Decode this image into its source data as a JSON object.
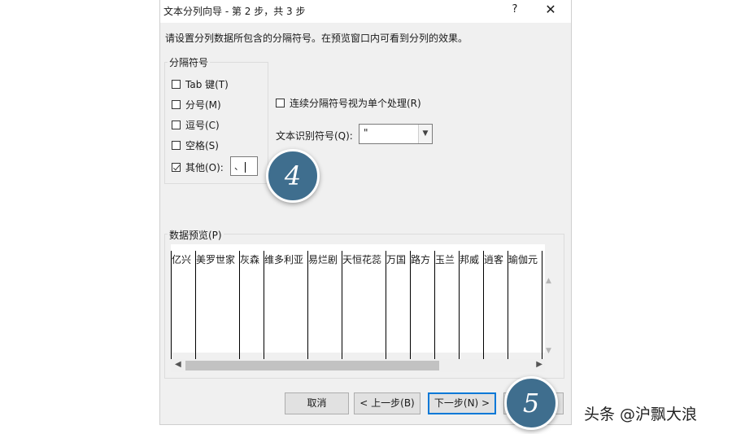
{
  "dialog": {
    "title": "文本分列向导 - 第 2 步，共 3 步",
    "help": "?",
    "close": "✕",
    "instruction": "请设置分列数据所包含的分隔符号。在预览窗口内可看到分列的效果。"
  },
  "delimiters": {
    "group_label": "分隔符号",
    "tab": {
      "label": "Tab 键(T)",
      "checked": false
    },
    "semicolon": {
      "label": "分号(M)",
      "checked": false
    },
    "comma": {
      "label": "逗号(C)",
      "checked": false
    },
    "space": {
      "label": "空格(S)",
      "checked": false
    },
    "other": {
      "label": "其他(O):",
      "checked": true,
      "value": "、"
    }
  },
  "consecutive": {
    "label": "连续分隔符号视为单个处理(R)",
    "checked": false
  },
  "text_qualifier": {
    "label": "文本识别符号(Q):",
    "value": "\""
  },
  "preview": {
    "label": "数据预览(P)",
    "columns": [
      "亿兴",
      "美罗世家",
      "灰森",
      "维多利亚",
      "易烂剧",
      "天恒花蕊",
      "万国",
      "路方",
      "玉兰",
      "邦威",
      "逍客",
      "瑜伽元"
    ]
  },
  "buttons": {
    "cancel": "取消",
    "back": "< 上一步(B)",
    "next": "下一步(N) >"
  },
  "annotations": {
    "step4": "4",
    "step5": "5"
  },
  "watermark": "头条 @沪飘大浪",
  "colors": {
    "circle": "#3f6e8e",
    "focus_border": "#0078d7",
    "dialog_bg": "#f0f0f0"
  }
}
